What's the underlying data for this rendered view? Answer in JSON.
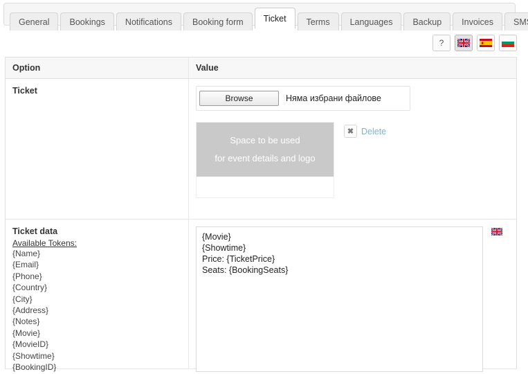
{
  "tabs": [
    {
      "label": "General",
      "active": false
    },
    {
      "label": "Bookings",
      "active": false
    },
    {
      "label": "Notifications",
      "active": false
    },
    {
      "label": "Booking form",
      "active": false
    },
    {
      "label": "Ticket",
      "active": true
    },
    {
      "label": "Terms",
      "active": false
    },
    {
      "label": "Languages",
      "active": false
    },
    {
      "label": "Backup",
      "active": false
    },
    {
      "label": "Invoices",
      "active": false
    },
    {
      "label": "SMS",
      "active": false
    }
  ],
  "toolbar": {
    "help_label": "?",
    "flags": [
      {
        "name": "flag-uk",
        "title": "English",
        "selected": true
      },
      {
        "name": "flag-spain",
        "title": "Espanol",
        "selected": false
      },
      {
        "name": "flag-bulgaria",
        "title": "Bulgarian",
        "selected": false
      }
    ]
  },
  "table": {
    "headers": {
      "option": "Option",
      "value": "Value"
    },
    "ticket_row": {
      "label": "Ticket",
      "browse_label": "Browse",
      "file_status": "Няма избрани файлове",
      "preview_text_line1": "Space to be used",
      "preview_text_line2": "for  event details and logo",
      "delete_icon": "✖",
      "delete_label": "Delete"
    },
    "ticket_data_row": {
      "label": "Ticket data",
      "tokens_heading": "Available Tokens:",
      "tokens": [
        "{Name}",
        "{Email}",
        "{Phone}",
        "{Country}",
        "{City}",
        "{Address}",
        "{Notes}",
        "{Movie}",
        "{MovieID}",
        "{Showtime}",
        "{BookingID}"
      ],
      "textarea_value": "{Movie}\n{Showtime}\nPrice: {TicketPrice}\nSeats: {BookingSeats}",
      "textarea_flag": "flag-uk"
    }
  },
  "colors": {
    "accent_link": "#7fb3d5",
    "placeholder_gray": "#c9c9c9",
    "tab_active_bg": "#ffffff",
    "tab_bg": "#eeeeee"
  }
}
